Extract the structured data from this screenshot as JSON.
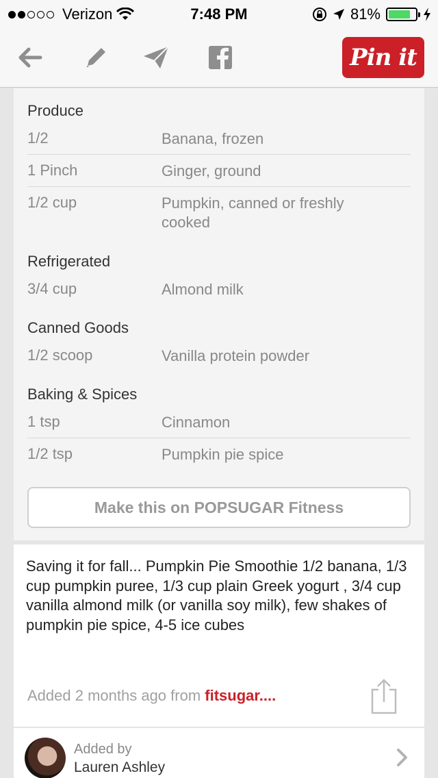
{
  "status_bar": {
    "carrier": "Verizon",
    "time": "7:48 PM",
    "battery": "81%",
    "battery_level": 0.81,
    "signal_dots_filled": 2,
    "signal_dots_total": 5
  },
  "toolbar": {
    "icons": [
      "back-arrow-icon",
      "pencil-icon",
      "send-icon",
      "facebook-icon"
    ],
    "pin_label": "Pin it",
    "pin_color": "#cb2027"
  },
  "ingredients": {
    "sections": [
      {
        "title": "Produce",
        "rows": [
          {
            "qty": "1/2",
            "item": "Banana, frozen"
          },
          {
            "qty": "1 Pinch",
            "item": "Ginger, ground"
          },
          {
            "qty": "1/2 cup",
            "item": "Pumpkin, canned or freshly cooked"
          }
        ]
      },
      {
        "title": "Refrigerated",
        "rows": [
          {
            "qty": "3/4 cup",
            "item": "Almond milk"
          }
        ]
      },
      {
        "title": "Canned Goods",
        "rows": [
          {
            "qty": "1/2 scoop",
            "item": "Vanilla protein powder"
          }
        ]
      },
      {
        "title": "Baking & Spices",
        "rows": [
          {
            "qty": "1 tsp",
            "item": "Cinnamon"
          },
          {
            "qty": "1/2 tsp",
            "item": "Pumpkin pie spice"
          }
        ]
      }
    ],
    "make_button": "Make this on POPSUGAR Fitness"
  },
  "description": {
    "text": "Saving it for fall... Pumpkin Pie Smoothie 1/2 banana, 1/3 cup pumpkin puree, 1/3 cup plain Greek yogurt , 3/4 cup vanilla almond milk (or vanilla soy milk), few shakes of pumpkin pie spice, 4-5 ice cubes",
    "added_prefix": "Added 2 months ago from ",
    "source": "fitsugar...."
  },
  "added_by": {
    "label": "Added by",
    "name": "Lauren Ashley"
  }
}
